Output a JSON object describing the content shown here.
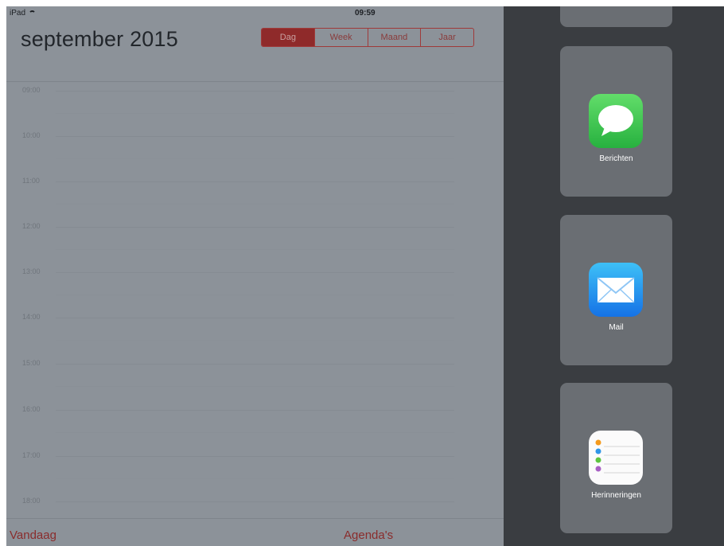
{
  "status_bar": {
    "device": "iPad",
    "time": "09:59"
  },
  "calendar": {
    "month_title": "september 2015",
    "view_tabs": [
      "Dag",
      "Week",
      "Maand",
      "Jaar"
    ],
    "selected_tab": "Dag",
    "hours": [
      "09:00",
      "10:00",
      "11:00",
      "12:00",
      "13:00",
      "14:00",
      "15:00",
      "16:00",
      "17:00",
      "18:00"
    ],
    "bottom_bar": {
      "today": "Vandaag",
      "calendars": "Agenda's"
    }
  },
  "slide_over": {
    "apps": [
      {
        "label": "Berichten",
        "icon": "messages-icon"
      },
      {
        "label": "Mail",
        "icon": "mail-icon"
      },
      {
        "label": "Herinneringen",
        "icon": "reminders-icon"
      }
    ]
  },
  "colors": {
    "accent_red": "#c0272d",
    "dim_overlay": "#8c9299",
    "slide_over_bg": "#3a3d41"
  }
}
